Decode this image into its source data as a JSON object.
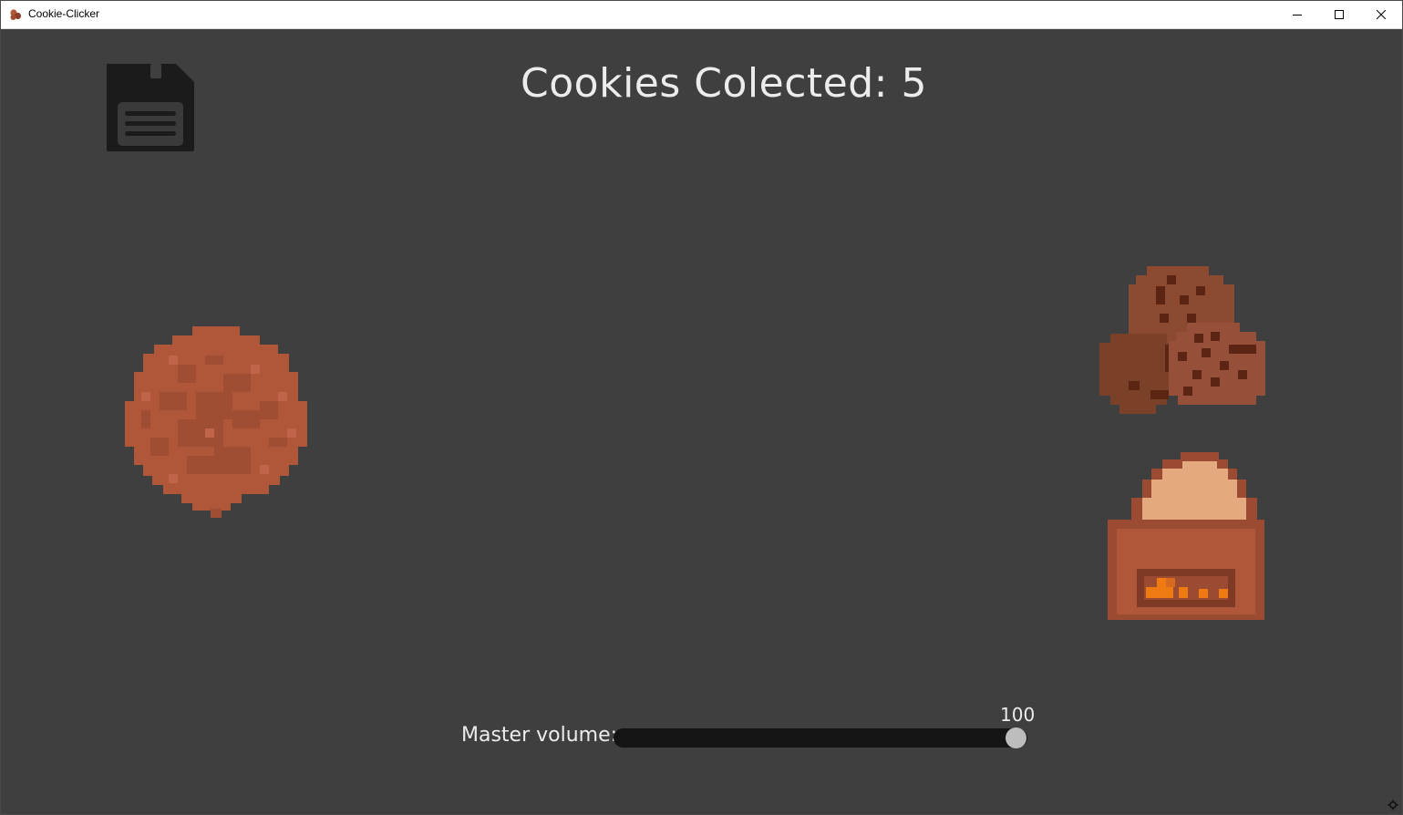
{
  "window": {
    "title": "Cookie-Clicker",
    "controls": [
      "minimize-icon",
      "maximize-icon",
      "close-icon"
    ]
  },
  "game": {
    "counter_text": "Cookies Colected: 5",
    "save_icon": "floppy-disk-icon",
    "big_cookie_icon": "cookie-icon",
    "shop": [
      {
        "name": "cookies-upgrade",
        "icon": "cookie-pile-icon"
      },
      {
        "name": "oven-upgrade",
        "icon": "oven-icon"
      }
    ]
  },
  "volume": {
    "label": "Master volume:",
    "value": "100",
    "level_percent": 100
  },
  "colors": {
    "background": "#3f3f3f",
    "text": "#ececec",
    "cookie": "#b0573a",
    "track": "#141414",
    "thumb": "#bdbdbd"
  }
}
